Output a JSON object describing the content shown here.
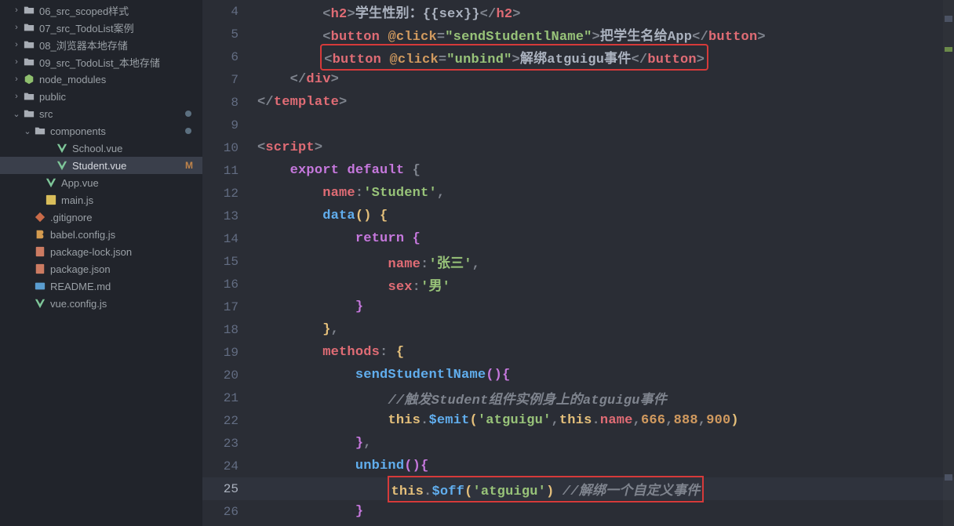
{
  "sidebar": {
    "items": [
      {
        "label": "06_src_scoped样式",
        "icon": "folder-icon",
        "indent": 14,
        "chev": "›"
      },
      {
        "label": "07_src_TodoList案例",
        "icon": "folder-icon",
        "indent": 14,
        "chev": "›"
      },
      {
        "label": "08_浏览器本地存储",
        "icon": "folder-icon",
        "indent": 14,
        "chev": "›"
      },
      {
        "label": "09_src_TodoList_本地存储",
        "icon": "folder-icon",
        "indent": 14,
        "chev": "›"
      },
      {
        "label": "node_modules",
        "icon": "node-icon",
        "indent": 14,
        "chev": "›"
      },
      {
        "label": "public",
        "icon": "folder-icon",
        "indent": 14,
        "chev": "›"
      },
      {
        "label": "src",
        "icon": "folder-icon",
        "indent": 14,
        "chev": "⌄",
        "dot": true
      },
      {
        "label": "components",
        "icon": "folder-icon",
        "indent": 28,
        "chev": "⌄",
        "dot": true
      },
      {
        "label": "School.vue",
        "icon": "vue-icon",
        "indent": 56
      },
      {
        "label": "Student.vue",
        "icon": "vue-icon",
        "indent": 56,
        "badge": "M",
        "selected": true
      },
      {
        "label": "App.vue",
        "icon": "vue-icon",
        "indent": 42
      },
      {
        "label": "main.js",
        "icon": "js-icon",
        "indent": 42
      },
      {
        "label": ".gitignore",
        "icon": "git-icon",
        "indent": 28
      },
      {
        "label": "babel.config.js",
        "icon": "babel-icon",
        "indent": 28
      },
      {
        "label": "package-lock.json",
        "icon": "json-icon",
        "indent": 28
      },
      {
        "label": "package.json",
        "icon": "json-icon",
        "indent": 28
      },
      {
        "label": "README.md",
        "icon": "md-icon",
        "indent": 28
      },
      {
        "label": "vue.config.js",
        "icon": "vue-icon",
        "indent": 28
      }
    ]
  },
  "editor": {
    "current_line": 25,
    "lines": [
      {
        "n": 4,
        "indent": "    ",
        "html": "<span class='pun'>&lt;</span><span class='tag'>h2</span><span class='pun'>&gt;</span><span class='txt'>学生性别：{{sex}}</span><span class='pun'>&lt;/</span><span class='tag'>h2</span><span class='pun'>&gt;</span>"
      },
      {
        "n": 5,
        "indent": "    ",
        "html": "<span class='pun'>&lt;</span><span class='tag'>button</span> <span class='attr'>@click</span><span class='pun'>=</span><span class='str'>\"sendStudentlName\"</span><span class='pun'>&gt;</span><span class='txt'>把学生名给App</span><span class='pun'>&lt;/</span><span class='tag'>button</span><span class='pun'>&gt;</span>"
      },
      {
        "n": 6,
        "indent": "    ",
        "box": "red",
        "html": "<span class='pun'>&lt;</span><span class='tag'>button</span> <span class='attr'>@click</span><span class='pun'>=</span><span class='str'>\"unbind\"</span><span class='pun'>&gt;</span><span class='txt'>解绑atguigu事件</span><span class='pun'>&lt;/</span><span class='tag'>button</span><span class='pun'>&gt;</span>"
      },
      {
        "n": 7,
        "indent": "  ",
        "html": "<span class='pun'>&lt;/</span><span class='tag'>div</span><span class='pun'>&gt;</span>"
      },
      {
        "n": 8,
        "indent": "",
        "html": "<span class='pun'>&lt;/</span><span class='tag'>template</span><span class='pun'>&gt;</span>"
      },
      {
        "n": 9,
        "indent": "",
        "html": ""
      },
      {
        "n": 10,
        "indent": "",
        "html": "<span class='pun'>&lt;</span><span class='tag'>script</span><span class='pun'>&gt;</span>"
      },
      {
        "n": 11,
        "indent": "  ",
        "html": "<span class='kw'>export</span> <span class='kw'>default</span> <span class='pun'>{</span>"
      },
      {
        "n": 12,
        "indent": "    ",
        "html": "<span class='name'>name</span><span class='pun'>:</span><span class='str'>'Student'</span><span class='pun'>,</span>"
      },
      {
        "n": 13,
        "indent": "    ",
        "html": "<span class='fn'>data</span><span class='yl'>()</span> <span class='yl'>{</span>"
      },
      {
        "n": 14,
        "indent": "      ",
        "html": "<span class='kw'>return</span> <span class='kw'>{</span>"
      },
      {
        "n": 15,
        "indent": "        ",
        "html": "<span class='name'>name</span><span class='pun'>:</span><span class='str'>'张三'</span><span class='pun'>,</span>"
      },
      {
        "n": 16,
        "indent": "        ",
        "html": "<span class='name'>sex</span><span class='pun'>:</span><span class='str'>'男'</span>"
      },
      {
        "n": 17,
        "indent": "      ",
        "html": "<span class='kw'>}</span>"
      },
      {
        "n": 18,
        "indent": "    ",
        "html": "<span class='yl'>}</span><span class='pun'>,</span>"
      },
      {
        "n": 19,
        "indent": "    ",
        "html": "<span class='name'>methods</span><span class='pun'>:</span> <span class='yl'>{</span>"
      },
      {
        "n": 20,
        "indent": "      ",
        "html": "<span class='fn'>sendStudentlName</span><span class='kw'>()</span><span class='kw'>{</span>"
      },
      {
        "n": 21,
        "indent": "        ",
        "html": "<span class='cmt'>//触发Student组件实例身上的atguigu事件</span>"
      },
      {
        "n": 22,
        "indent": "        ",
        "html": "<span class='this'>this</span><span class='pun'>.</span><span class='fn'>$emit</span><span class='yl'>(</span><span class='str'>'atguigu'</span><span class='pun'>,</span><span class='this'>this</span><span class='pun'>.</span><span class='name'>name</span><span class='pun'>,</span><span class='num'>666</span><span class='pun'>,</span><span class='num'>888</span><span class='pun'>,</span><span class='num'>900</span><span class='yl'>)</span>"
      },
      {
        "n": 23,
        "indent": "      ",
        "html": "<span class='kw'>}</span><span class='pun'>,</span>"
      },
      {
        "n": 24,
        "indent": "      ",
        "html": "<span class='fn'>unbind</span><span class='kw'>()</span><span class='kw'>{</span>"
      },
      {
        "n": 25,
        "indent": "        ",
        "box": "red",
        "html": "<span class='this'>this</span><span class='pun'>.</span><span class='fn'>$off</span><span class='yl'>(</span><span class='str'>'atguigu'</span><span class='yl'>)</span> <span class='cmt'>//解绑一个自定义事件</span>"
      },
      {
        "n": 26,
        "indent": "      ",
        "html": "<span class='kw'>}</span>"
      }
    ]
  }
}
